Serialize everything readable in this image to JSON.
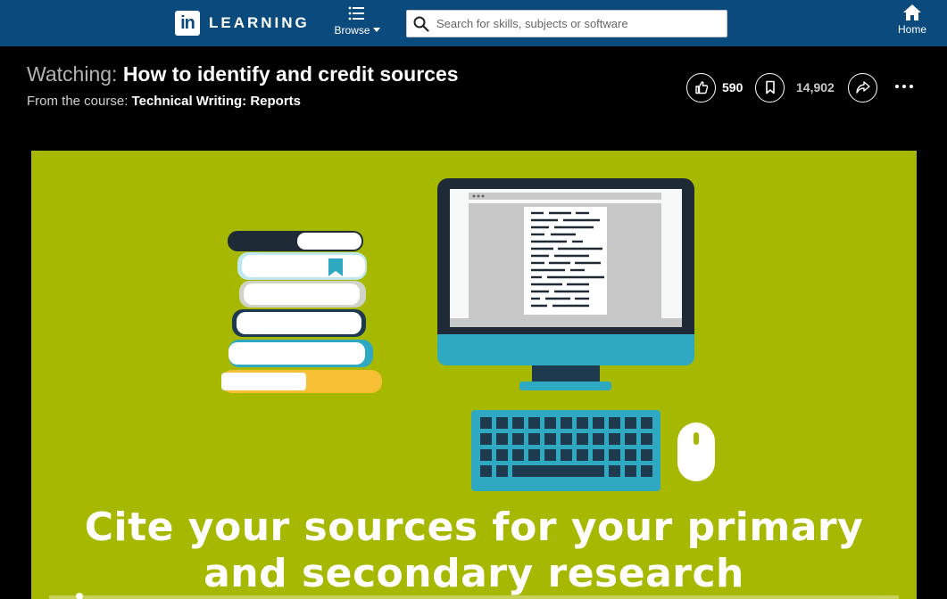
{
  "header": {
    "logo_mark": "in",
    "logo_text": "LEARNING",
    "browse_label": "Browse",
    "search_placeholder": "Search for skills, subjects or software",
    "home_label": "Home"
  },
  "video_info": {
    "watching_prefix": "Watching:",
    "title": "How to identify and credit sources",
    "course_prefix": "From the course:",
    "course_name": "Technical Writing: Reports"
  },
  "actions": {
    "like_count": "590",
    "save_count": "14,902"
  },
  "slide": {
    "caption_line1": "Cite your sources for your primary",
    "caption_line2": "and secondary research",
    "background_color": "#a7b800"
  },
  "icons": [
    "list-icon",
    "search-icon",
    "home-icon",
    "thumbs-up-icon",
    "bookmark-icon",
    "share-icon",
    "more-icon"
  ],
  "colors": {
    "brand_bar": "#0b4a7d",
    "teal": "#2fa9c1",
    "navy": "#1e2a36",
    "yellow": "#f6bf34"
  }
}
